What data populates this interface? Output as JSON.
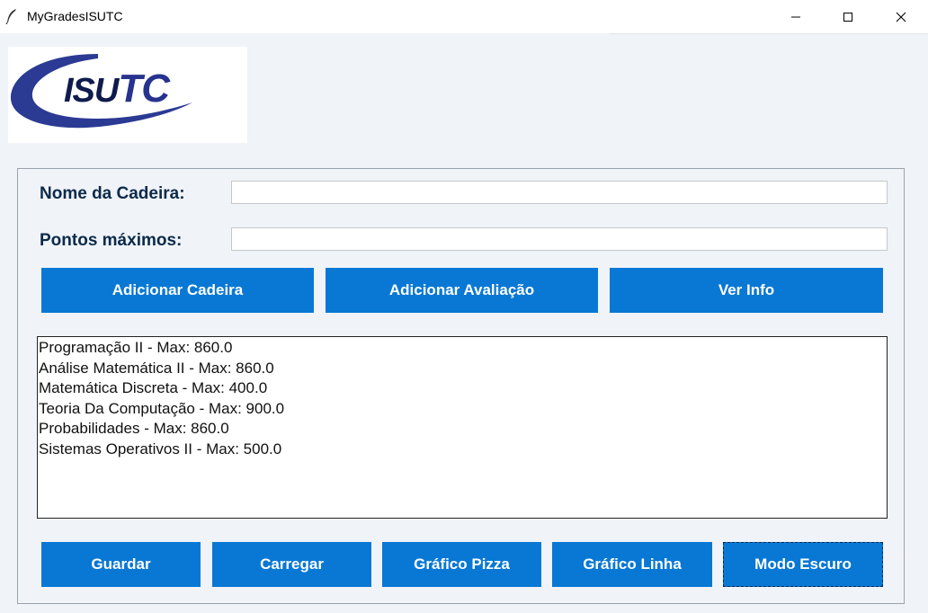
{
  "window": {
    "title": "MyGradesISUTC",
    "icon": "feather-icon",
    "controls": [
      "minimize-icon",
      "maximize-icon",
      "close-icon"
    ]
  },
  "logo": {
    "text_isu": "ISU",
    "text_tc": "TC",
    "colors": {
      "swoosh": "#2b3a93",
      "text": "#0f1b4d"
    }
  },
  "form": {
    "nome_label": "Nome da Cadeira:",
    "nome_value": "",
    "pontos_label": "Pontos máximos:",
    "pontos_value": ""
  },
  "top_buttons": {
    "adicionar_cadeira": "Adicionar Cadeira",
    "adicionar_avaliacao": "Adicionar Avaliação",
    "ver_info": "Ver Info"
  },
  "list": {
    "items": [
      "Programação II - Max: 860.0",
      "Análise Matemática II - Max: 860.0",
      "Matemática Discreta - Max: 400.0",
      "Teoria Da Computação - Max: 900.0",
      "Probabilidades - Max: 860.0",
      "Sistemas Operativos II - Max: 500.0"
    ]
  },
  "bottom_buttons": {
    "guardar": "Guardar",
    "carregar": "Carregar",
    "grafico_pizza": "Gráfico Pizza",
    "grafico_linha": "Gráfico Linha",
    "modo_escuro": "Modo Escuro"
  },
  "colors": {
    "accent": "#0878d4",
    "label": "#0b2a4a",
    "background": "#f0f3f8"
  }
}
